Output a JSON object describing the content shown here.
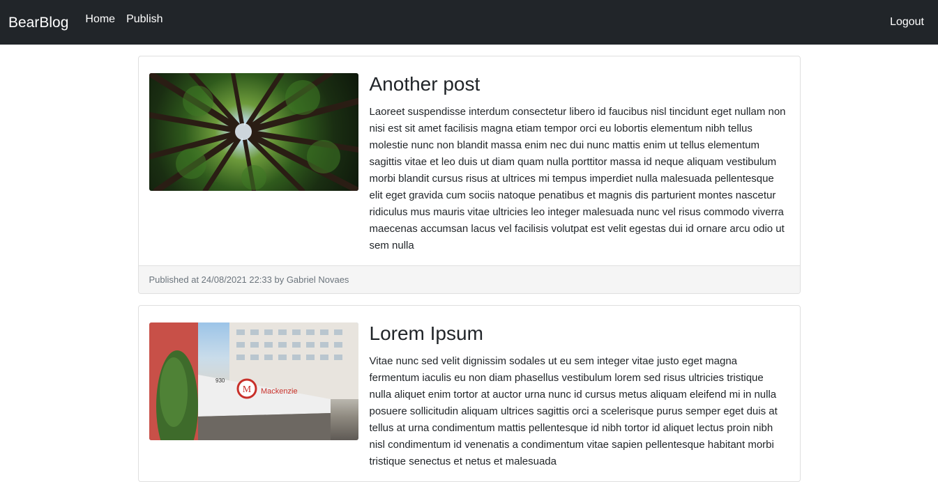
{
  "nav": {
    "brand": "BearBlog",
    "links": [
      "Home",
      "Publish"
    ],
    "logout": "Logout"
  },
  "posts": [
    {
      "title": "Another post",
      "body": "Laoreet suspendisse interdum consectetur libero id faucibus nisl tincidunt eget nullam non nisi est sit amet facilisis magna etiam tempor orci eu lobortis elementum nibh tellus molestie nunc non blandit massa enim nec dui nunc mattis enim ut tellus elementum sagittis vitae et leo duis ut diam quam nulla porttitor massa id neque aliquam vestibulum morbi blandit cursus risus at ultrices mi tempus imperdiet nulla malesuada pellentesque elit eget gravida cum sociis natoque penatibus et magnis dis parturient montes nascetur ridiculus mus mauris vitae ultricies leo integer malesuada nunc vel risus commodo viverra maecenas accumsan lacus vel facilisis volutpat est velit egestas dui id ornare arcu odio ut sem nulla",
      "footer": "Published at 24/08/2021 22:33 by Gabriel Novaes"
    },
    {
      "title": "Lorem Ipsum",
      "body": "Vitae nunc sed velit dignissim sodales ut eu sem integer vitae justo eget magna fermentum iaculis eu non diam phasellus vestibulum lorem sed risus ultricies tristique nulla aliquet enim tortor at auctor urna nunc id cursus metus aliquam eleifend mi in nulla posuere sollicitudin aliquam ultrices sagittis orci a scelerisque purus semper eget duis at tellus at urna condimentum mattis pellentesque id nibh tortor id aliquet lectus proin nibh nisl condimentum id venenatis a condimentum vitae sapien pellentesque habitant morbi tristique senectus et netus et malesuada"
    }
  ],
  "images": {
    "post0": {
      "icon": "forest-canopy-photo",
      "signage": ""
    },
    "post1": {
      "icon": "mackenzie-building-photo",
      "sign_text": "Mackenzie",
      "logo_letter": "M",
      "number": "930"
    }
  }
}
